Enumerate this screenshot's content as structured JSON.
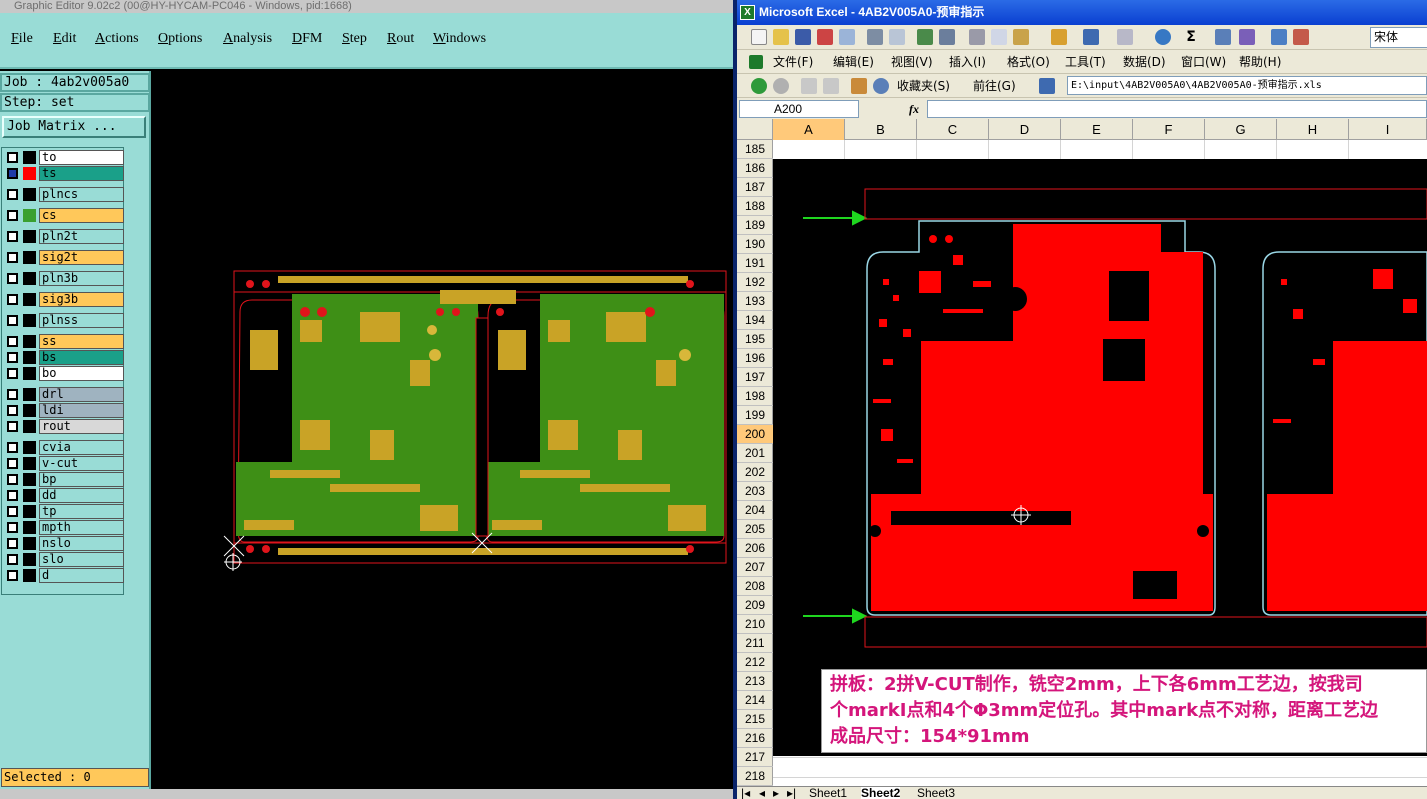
{
  "graphic_editor": {
    "title": "Graphic Editor 9.02c2 (00@HY-HYCAM-PC046 - Windows, pid:1668)",
    "menu": [
      "File",
      "Edit",
      "Actions",
      "Options",
      "Analysis",
      "DFM",
      "Step",
      "Rout",
      "Windows"
    ],
    "job_label": "Job : 4ab2v005a0",
    "step_label": "Step: set",
    "job_matrix_button": "Job Matrix ...",
    "layers": [
      {
        "name": "to",
        "color": "#ffffff",
        "swatch": "#000000",
        "checked": false
      },
      {
        "name": "ts",
        "color": "#1aa089",
        "swatch": "#ff0000",
        "checked": true
      },
      {
        "name": "plncs",
        "color": "#99dcd6",
        "swatch": "#000000",
        "checked": false
      },
      {
        "name": "cs",
        "color": "#ffc85a",
        "swatch": "#3aa030",
        "checked": false
      },
      {
        "name": "pln2t",
        "color": "#99dcd6",
        "swatch": "#000000",
        "checked": false
      },
      {
        "name": "sig2t",
        "color": "#ffc85a",
        "swatch": "#000000",
        "checked": false
      },
      {
        "name": "pln3b",
        "color": "#99dcd6",
        "swatch": "#000000",
        "checked": false
      },
      {
        "name": "sig3b",
        "color": "#ffc85a",
        "swatch": "#000000",
        "checked": false
      },
      {
        "name": "plnss",
        "color": "#99dcd6",
        "swatch": "#000000",
        "checked": false
      },
      {
        "name": "ss",
        "color": "#ffc85a",
        "swatch": "#000000",
        "checked": false
      },
      {
        "name": "bs",
        "color": "#1aa089",
        "swatch": "#000000",
        "checked": false
      },
      {
        "name": "bo",
        "color": "#ffffff",
        "swatch": "#000000",
        "checked": false
      },
      {
        "name": "drl",
        "color": "#9fb3c0",
        "swatch": "#000000",
        "checked": false
      },
      {
        "name": "ldi",
        "color": "#9fb3c0",
        "swatch": "#000000",
        "checked": false
      },
      {
        "name": "rout",
        "color": "#d8d8d8",
        "swatch": "#000000",
        "checked": false
      },
      {
        "name": "cvia",
        "color": "#99dcd6",
        "swatch": "#000000",
        "checked": false
      },
      {
        "name": "v-cut",
        "color": "#99dcd6",
        "swatch": "#000000",
        "checked": false
      },
      {
        "name": "bp",
        "color": "#99dcd6",
        "swatch": "#000000",
        "checked": false
      },
      {
        "name": "dd",
        "color": "#99dcd6",
        "swatch": "#000000",
        "checked": false
      },
      {
        "name": "tp",
        "color": "#99dcd6",
        "swatch": "#000000",
        "checked": false
      },
      {
        "name": "mpth",
        "color": "#99dcd6",
        "swatch": "#000000",
        "checked": false
      },
      {
        "name": "nslo",
        "color": "#99dcd6",
        "swatch": "#000000",
        "checked": false
      },
      {
        "name": "slo",
        "color": "#99dcd6",
        "swatch": "#000000",
        "checked": false
      },
      {
        "name": "d",
        "color": "#99dcd6",
        "swatch": "#000000",
        "checked": false
      }
    ],
    "selected_label": "Selected : 0",
    "colors": {
      "panel": "#99dcd6",
      "board": "#3e8f16",
      "pad": "#c9a326",
      "outline": "#e0141b"
    }
  },
  "excel": {
    "title": "Microsoft Excel - 4AB2V005A0-预审指示",
    "menu": [
      "文件(F)",
      "编辑(E)",
      "视图(V)",
      "插入(I)",
      "格式(O)",
      "工具(T)",
      "数据(D)",
      "窗口(W)",
      "帮助(H)"
    ],
    "font_name": "宋体",
    "favorites": "收藏夹(S)",
    "goto": "前往(G)",
    "path": "E:\\input\\4AB2V005A0\\4AB2V005A0-预审指示.xls",
    "name_box": "A200",
    "fx": "fx",
    "columns": [
      "A",
      "B",
      "C",
      "D",
      "E",
      "F",
      "G",
      "H",
      "I"
    ],
    "selected_column": "A",
    "rows": [
      "185",
      "186",
      "187",
      "188",
      "189",
      "190",
      "191",
      "192",
      "193",
      "194",
      "195",
      "196",
      "197",
      "198",
      "199",
      "200",
      "201",
      "202",
      "203",
      "204",
      "205",
      "206",
      "207",
      "208",
      "209",
      "210",
      "211",
      "212",
      "213",
      "214",
      "215",
      "216",
      "217",
      "218"
    ],
    "selected_row": "200",
    "note_lines": [
      "拼板：2拼V-CUT制作，铣空2mm，上下各6mm工艺边，按我司",
      "个markI点和4个Φ3mm定位孔。其中mark点不对称，距离工艺边",
      "成品尺寸：154*91mm"
    ],
    "sheets": [
      "Sheet1",
      "Sheet2",
      "Sheet3"
    ],
    "colors": {
      "titlebar": "#0a3fd1",
      "copper": "#ff0000",
      "note_text": "#d4157b",
      "arrow": "#1fd61f",
      "outline": "#9ad7e6"
    }
  }
}
